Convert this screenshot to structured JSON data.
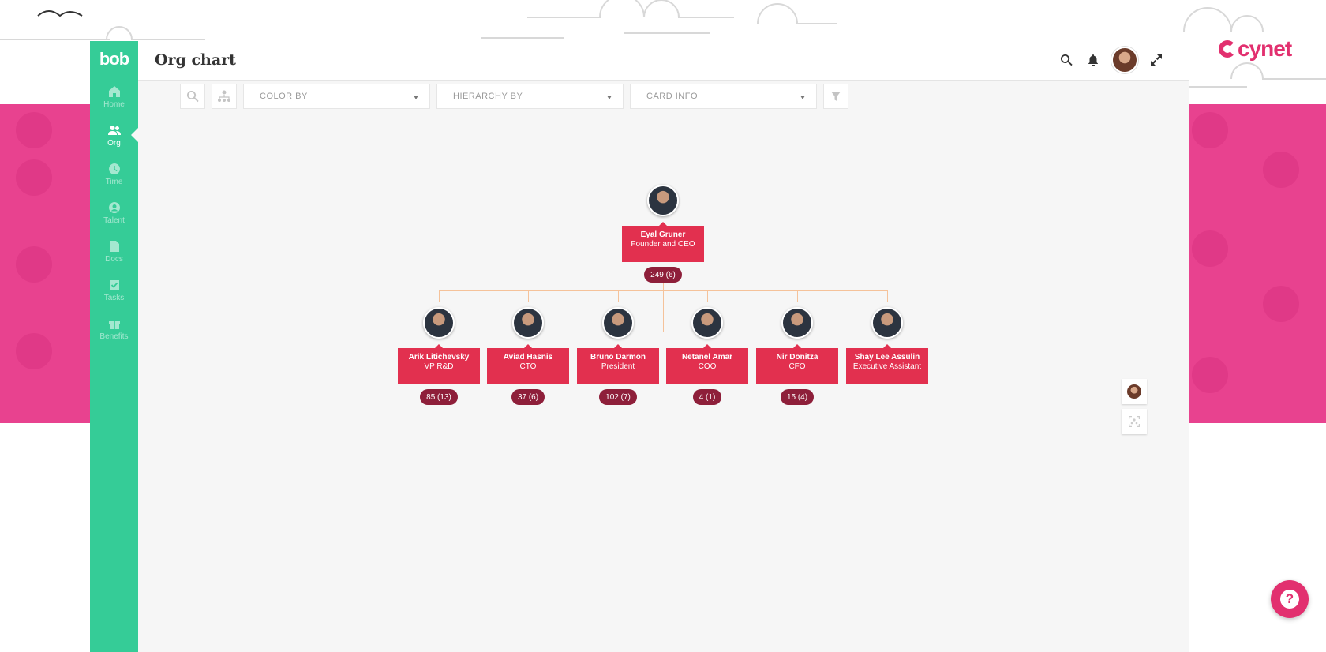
{
  "app": {
    "logo": "bob",
    "page_title": "Org chart",
    "brand": "cynet"
  },
  "sidebar": {
    "items": [
      {
        "label": "Home",
        "icon": "home-icon",
        "active": false
      },
      {
        "label": "Org",
        "icon": "people-icon",
        "active": true
      },
      {
        "label": "Time",
        "icon": "clock-icon",
        "active": false
      },
      {
        "label": "Talent",
        "icon": "person-circle-icon",
        "active": false
      },
      {
        "label": "Docs",
        "icon": "document-icon",
        "active": false
      },
      {
        "label": "Tasks",
        "icon": "checkbox-icon",
        "active": false
      },
      {
        "label": "Benefits",
        "icon": "gift-icon",
        "active": false
      }
    ]
  },
  "toolbar": {
    "color_by": "COLOR BY",
    "hierarchy_by": "HIERARCHY BY",
    "card_info": "CARD INFO"
  },
  "org": {
    "root": {
      "name": "Eyal Gruner",
      "role": "Founder and CEO",
      "count": "249 (6)"
    },
    "reports": [
      {
        "name": "Arik Litichevsky",
        "role": "VP R&D",
        "count": "85 (13)"
      },
      {
        "name": "Aviad Hasnis",
        "role": "CTO",
        "count": "37 (6)"
      },
      {
        "name": "Bruno Darmon",
        "role": "President",
        "count": "102 (7)"
      },
      {
        "name": "Netanel Amar",
        "role": "COO",
        "count": "4 (1)"
      },
      {
        "name": "Nir Donitza",
        "role": "CFO",
        "count": "15 (4)"
      },
      {
        "name": "Shay Lee Assulin",
        "role": "Executive Assistant",
        "count": ""
      }
    ]
  },
  "colors": {
    "sidebar": "#35cc97",
    "card": "#e2304f",
    "count_badge": "#8e1f3a",
    "connector": "#f5c29a",
    "brand": "#e2306f"
  }
}
